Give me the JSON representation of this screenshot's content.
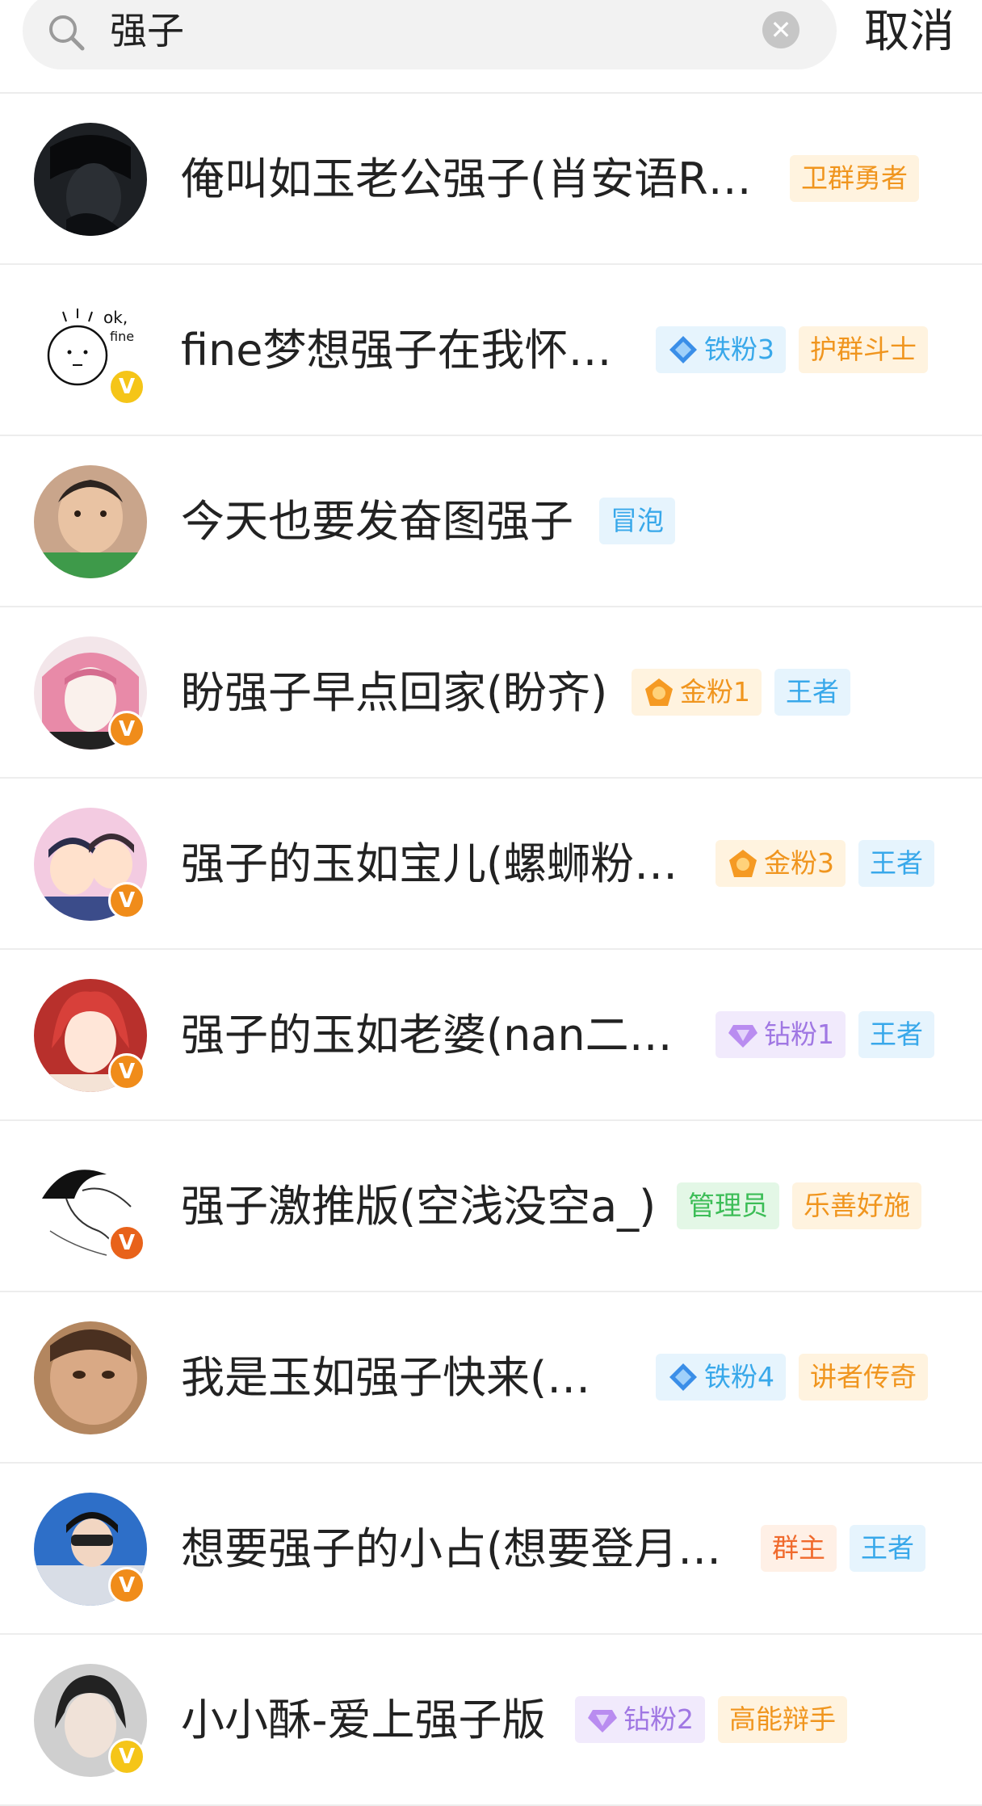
{
  "search": {
    "query": "强子",
    "cancel_label": "取消"
  },
  "results": [
    {
      "name": "俺叫如玉老公强子(肖安语R…",
      "tags": [
        "卫群勇者"
      ]
    },
    {
      "name": "fine梦想强子在我怀…",
      "tags": [
        "铁粉3",
        "护群斗士"
      ]
    },
    {
      "name": "今天也要发奋图强子",
      "tags": [
        "冒泡"
      ]
    },
    {
      "name": "盼强子早点回家(盼齐)",
      "tags": [
        "金粉1",
        "王者"
      ]
    },
    {
      "name": "强子的玉如宝儿(螺蛳粉…",
      "tags": [
        "金粉3",
        "王者"
      ]
    },
    {
      "name": "强子的玉如老婆(nan二…",
      "tags": [
        "钻粉1",
        "王者"
      ]
    },
    {
      "name": "强子激推版(空浅没空a_)",
      "tags": [
        "管理员",
        "乐善好施"
      ]
    },
    {
      "name": "我是玉如强子快来(…",
      "tags": [
        "铁粉4",
        "讲者传奇"
      ]
    },
    {
      "name": "想要强子的小占(想要登月…",
      "tags": [
        "群主",
        "王者"
      ]
    },
    {
      "name": "小小酥-爱上强子版",
      "tags": [
        "钻粉2",
        "高能辩手"
      ]
    }
  ],
  "colors": {
    "badge_v": "#f08c1a",
    "tag_orange": "#f0951e",
    "tag_blue": "#38a8ea",
    "tag_green": "#3cbd57",
    "tag_purple": "#a077e3"
  }
}
